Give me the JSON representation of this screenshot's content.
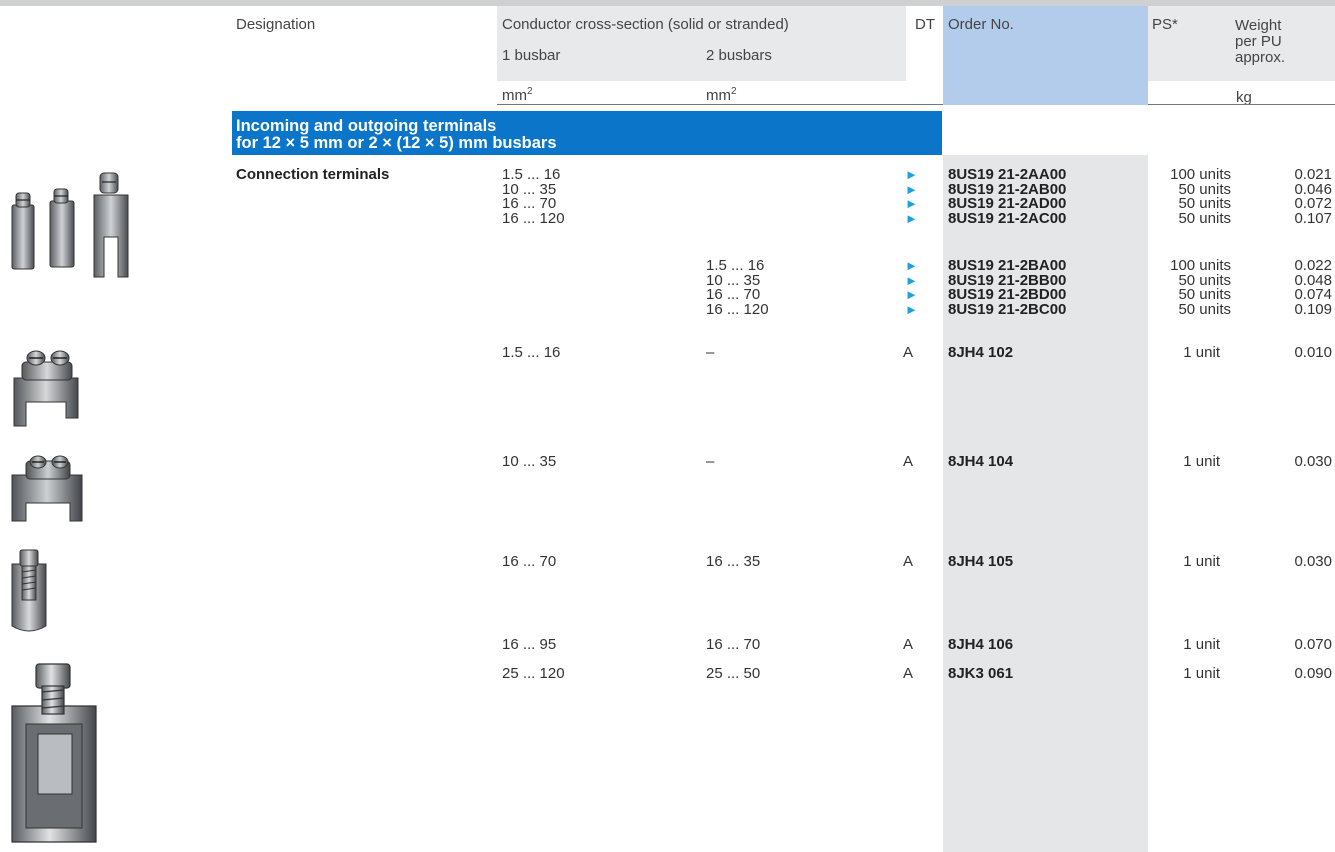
{
  "header": {
    "designation": "Designation",
    "cross_section": "Conductor cross-section (solid or stranded)",
    "one_busbar": "1 busbar",
    "two_busbars": "2 busbars",
    "dt": "DT",
    "order_no": "Order No.",
    "ps": "PS*",
    "weight": "Weight",
    "weight_2": "per PU",
    "weight_3": "approx.",
    "unit_mm": "mm",
    "unit_mm_sup": "2",
    "unit_mm2": "mm",
    "unit_mm2_sup": "2",
    "unit_kg": "kg"
  },
  "section": {
    "line1": "Incoming and outgoing terminals",
    "line2": "for 12 × 5 mm or 2 × (12 × 5) mm busbars"
  },
  "group1": {
    "designation": "Connection terminals",
    "one_busbar": "1.5 ... 16\n10 ... 35\n16 ... 70\n16 ... 120",
    "dt": "►\n►\n►\n►",
    "order": "8US19 21-2AA00\n8US19 21-2AB00\n8US19 21-2AD00\n8US19 21-2AC00",
    "ps": "100 units\n50 units\n50 units\n50 units",
    "weight": "0.021\n0.046\n0.072\n0.107"
  },
  "group2": {
    "two_busbars": "1.5 ... 16\n10 ... 35\n16 ... 70\n16 ... 120",
    "dt": "►\n►\n►\n►",
    "order": "8US19 21-2BA00\n8US19 21-2BB00\n8US19 21-2BD00\n8US19 21-2BC00",
    "ps": "100 units\n50 units\n50 units\n50 units",
    "weight": "0.022\n0.048\n0.074\n0.109"
  },
  "rows": [
    {
      "one": "1.5 ... 16",
      "two": "–",
      "dt": "A",
      "order": "8JH4 102",
      "ps": "1 unit",
      "weight": "0.010"
    },
    {
      "one": "10 ... 35",
      "two": "–",
      "dt": "A",
      "order": "8JH4 104",
      "ps": "1 unit",
      "weight": "0.030"
    },
    {
      "one": "16 ... 70",
      "two": "16 ... 35",
      "dt": "A",
      "order": "8JH4 105",
      "ps": "1 unit",
      "weight": "0.030"
    },
    {
      "one": "16 ... 95",
      "two": "16 ... 70",
      "dt": "A",
      "order": "8JH4 106",
      "ps": "1 unit",
      "weight": "0.070"
    },
    {
      "one": "25 ... 120",
      "two": "25 ... 50",
      "dt": "A",
      "order": "8JK3 061",
      "ps": "1 unit",
      "weight": "0.090"
    }
  ],
  "colors": {
    "banner": "#0b76c9",
    "order_header": "#b3cceb",
    "arrow": "#1ca0e3",
    "header_bg": "#e8e9ea"
  }
}
